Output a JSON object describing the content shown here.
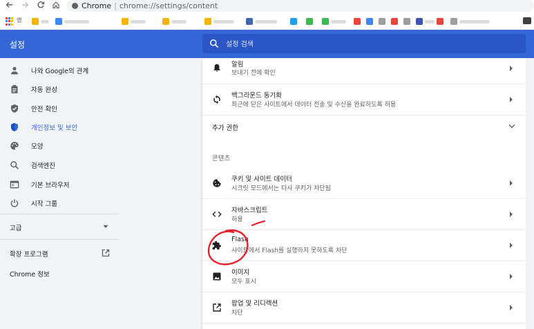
{
  "browser": {
    "url_host": "Chrome",
    "url_separator": "|",
    "url_path": "chrome://settings/content",
    "bookmarks_apps_label": "앱"
  },
  "header": {
    "title": "설정",
    "search_placeholder": "설정 검색"
  },
  "sidebar": {
    "items": [
      {
        "label": "나와 Google의 관계",
        "icon": "person-icon"
      },
      {
        "label": "자동 완성",
        "icon": "clipboard-icon"
      },
      {
        "label": "안전 확인",
        "icon": "shield-check-icon"
      },
      {
        "label": "개인정보 및 보안",
        "icon": "shield-icon",
        "active": true
      },
      {
        "label": "모양",
        "icon": "palette-icon"
      },
      {
        "label": "검색엔진",
        "icon": "search-icon"
      },
      {
        "label": "기본 브라우저",
        "icon": "browser-icon"
      },
      {
        "label": "시작 그룹",
        "icon": "power-icon"
      }
    ],
    "advanced_label": "고급",
    "extensions_label": "확장 프로그램",
    "about_label": "Chrome 정보"
  },
  "content": {
    "notifications": {
      "title": "알림",
      "sub": "보내기 전에 확인"
    },
    "background_sync": {
      "title": "백그라운드 동기화",
      "sub": "최근에 닫은 사이트에서 데이터 전송 및 수신을 완료하도록 허용"
    },
    "additional_permissions": "추가 권한",
    "content_section": "콘텐츠",
    "cookies": {
      "title": "쿠키 및 사이트 데이터",
      "sub": "시크릿 모드에서는 타사 쿠키가 차단됨"
    },
    "javascript": {
      "title": "자바스크립트",
      "sub": "허용"
    },
    "flash": {
      "title": "Flash",
      "sub": "사이트에서 Flash를 실행하지 못하도록 차단"
    },
    "images": {
      "title": "이미지",
      "sub": "모두 표시"
    },
    "popups": {
      "title": "팝업 및 리디렉션",
      "sub": "차단"
    }
  },
  "colors": {
    "header_blue": "#3367d6",
    "active_blue": "#3367d6",
    "annotation_red": "#e8202a"
  }
}
